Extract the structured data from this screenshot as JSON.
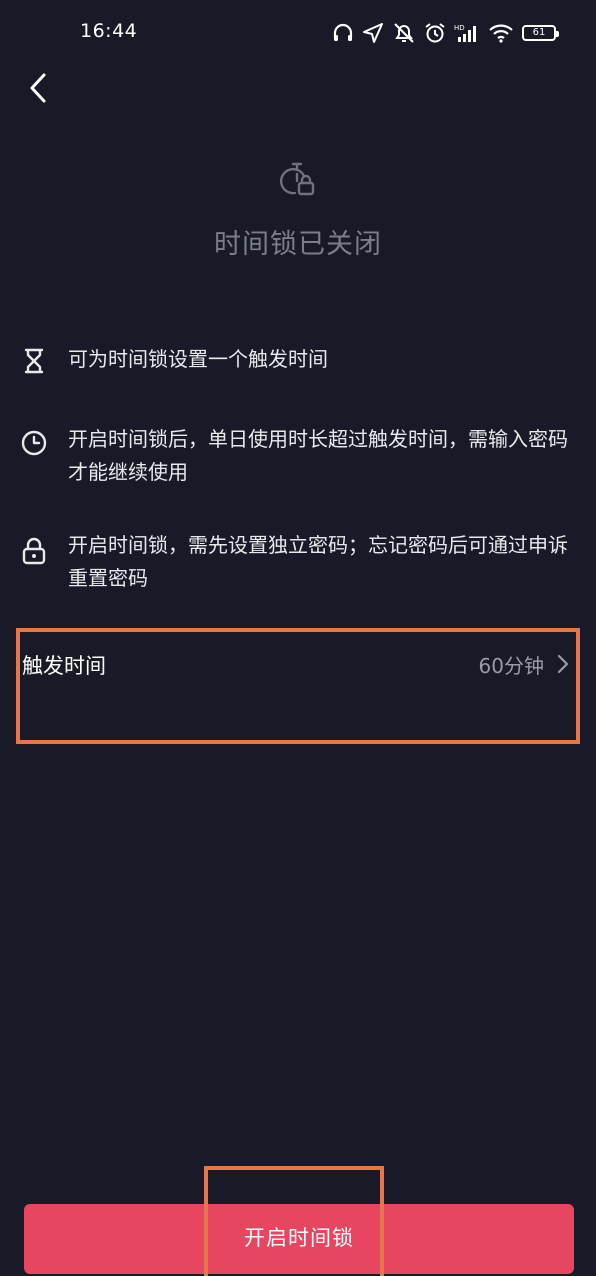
{
  "status_bar": {
    "time": "16:44",
    "battery_level": "61",
    "icons": [
      "headphones-icon",
      "location-icon",
      "mute-icon",
      "alarm-icon",
      "hd-signal-icon",
      "wifi-icon",
      "battery-icon"
    ]
  },
  "header": {
    "back_icon": "chevron-left-icon"
  },
  "hero": {
    "icon": "timer-lock-icon",
    "title": "时间锁已关闭"
  },
  "features": [
    {
      "icon": "hourglass-icon",
      "text": "可为时间锁设置一个触发时间"
    },
    {
      "icon": "clock-icon",
      "text": "开启时间锁后，单日使用时长超过触发时间，需输入密码才能继续使用"
    },
    {
      "icon": "lock-icon",
      "text": "开启时间锁，需先设置独立密码；忘记密码后可通过申诉重置密码"
    }
  ],
  "trigger_time": {
    "label": "触发时间",
    "value": "60分钟",
    "chevron_icon": "chevron-right-icon"
  },
  "enable_button": {
    "label": "开启时间锁"
  },
  "colors": {
    "background": "#181a27",
    "primary": "#e84561",
    "highlight": "#e57848",
    "muted_text": "#7b7d89"
  }
}
